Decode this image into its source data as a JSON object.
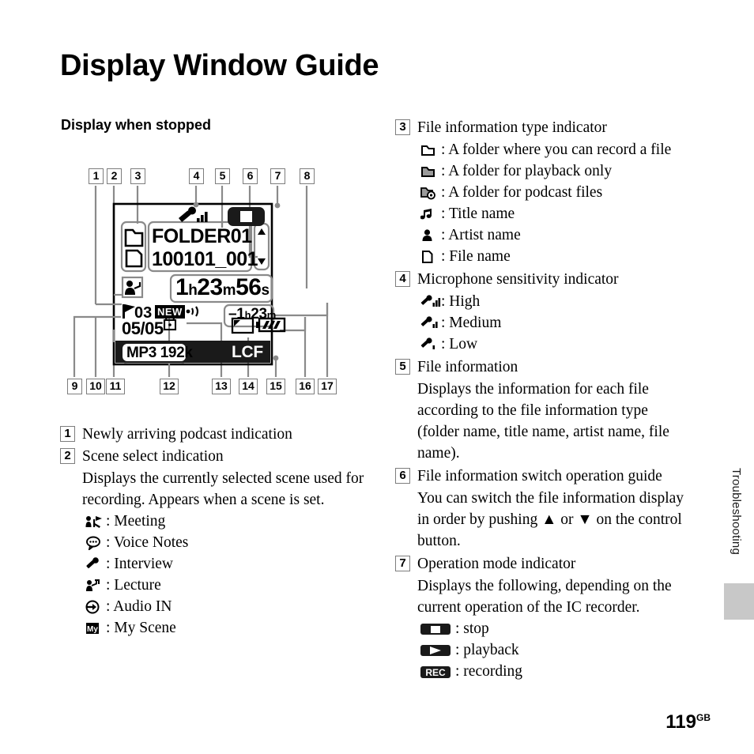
{
  "page": {
    "title": "Display Window Guide",
    "section_heading": "Display when stopped",
    "side_tab_label": "Troubleshooting",
    "page_number": "119",
    "page_number_suffix": "GB"
  },
  "lcd": {
    "folder_name": "FOLDER01",
    "file_name": "100101_001",
    "elapsed_hours": "1",
    "elapsed_h_unit": "h",
    "elapsed_minutes": "23",
    "elapsed_m_unit": "m",
    "elapsed_seconds": "56",
    "elapsed_s_unit": "s",
    "remain_sign": "–",
    "remain_hours": "1",
    "remain_h_unit": "h",
    "remain_minutes": "23",
    "remain_m_unit": "m",
    "track_mark": "03",
    "new_badge": "NEW",
    "file_counter": "05/05",
    "codec_badge": "MP3 192k",
    "lcf_badge": "LCF",
    "callouts": [
      "1",
      "2",
      "3",
      "4",
      "5",
      "6",
      "7",
      "8",
      "9",
      "10",
      "11",
      "12",
      "13",
      "14",
      "15",
      "16",
      "17"
    ]
  },
  "left_column": [
    {
      "num": "1",
      "title": "Newly arriving podcast indication"
    },
    {
      "num": "2",
      "title": "Scene select indication",
      "body": "Displays the currently selected scene used for recording. Appears when a scene is set.",
      "icon_items": [
        {
          "icon": "meeting-icon",
          "label": ": Meeting"
        },
        {
          "icon": "voice-notes-icon",
          "label": ": Voice Notes"
        },
        {
          "icon": "interview-icon",
          "label": ": Interview"
        },
        {
          "icon": "lecture-icon",
          "label": ": Lecture"
        },
        {
          "icon": "audio-in-icon",
          "label": ": Audio IN"
        },
        {
          "icon": "my-scene-icon",
          "label": ": My Scene"
        }
      ]
    }
  ],
  "right_column": [
    {
      "num": "3",
      "title": "File information type indicator",
      "icon_items": [
        {
          "icon": "folder-recordable-icon",
          "label": ": A folder where you can record a file"
        },
        {
          "icon": "folder-playback-icon",
          "label": ": A folder for playback only"
        },
        {
          "icon": "folder-podcast-icon",
          "label": ": A folder for podcast files"
        },
        {
          "icon": "music-note-icon",
          "label": ": Title name"
        },
        {
          "icon": "artist-person-icon",
          "label": ": Artist name"
        },
        {
          "icon": "file-page-icon",
          "label": ": File name"
        }
      ]
    },
    {
      "num": "4",
      "title": "Microphone sensitivity indicator",
      "icon_items": [
        {
          "icon": "mic-high-icon",
          "label": ": High"
        },
        {
          "icon": "mic-medium-icon",
          "label": ": Medium"
        },
        {
          "icon": "mic-low-icon",
          "label": ": Low"
        }
      ]
    },
    {
      "num": "5",
      "title": "File information",
      "body": "Displays the information for each file according to the file information type (folder name, title name, artist name, file name)."
    },
    {
      "num": "6",
      "title": "File information switch operation guide",
      "body": "You can switch the file information display in order by pushing ▲ or ▼ on the control button."
    },
    {
      "num": "7",
      "title": "Operation mode indicator",
      "body": "Displays the following, depending on the current operation of the IC recorder.",
      "icon_items": [
        {
          "icon": "stop-mode-icon",
          "label": ": stop"
        },
        {
          "icon": "playback-mode-icon",
          "label": ": playback"
        },
        {
          "icon": "rec-mode-icon",
          "label": ": recording"
        }
      ]
    }
  ],
  "colors": {
    "leader_line": "#8a8a8a",
    "box_border": "#7d7d7d",
    "ink": "#000000",
    "tab_block": "#c8c8c8"
  }
}
